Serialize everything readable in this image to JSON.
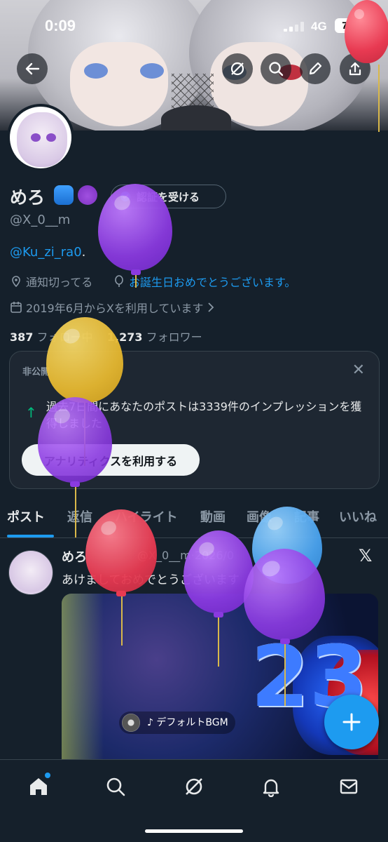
{
  "status_bar": {
    "time": "0:09",
    "network": "4G",
    "battery": "77"
  },
  "profile": {
    "name": "めろ",
    "verify_button": "認証を受ける",
    "handle": "@X_0__m",
    "bio_link": "@Ku_zi_ra0",
    "bio_suffix": ".",
    "location": "通知切ってる",
    "birthday_link": "お誕生日おめでとうございます。",
    "joined": "2019年6月からXを利用しています",
    "following_count": "387",
    "following_label": "フォロー中",
    "followers_count": "1,273",
    "followers_label": "フォロワー"
  },
  "analytics_card": {
    "tag": "非公開",
    "message": "過去7日間にあなたのポストは3339件のインプレッションを獲得しました",
    "cta": "アナリティクスを利用する"
  },
  "tabs": [
    "ポスト",
    "返信",
    "ハイライト",
    "動画",
    "画像",
    "記事",
    "いいね"
  ],
  "post": {
    "name": "めろ",
    "handle_date": "@X_0__m·2026/0",
    "text": "あけましておめでとうございます",
    "image_label": "♪ デフォルトBGM",
    "image_number": "23"
  },
  "colors": {
    "accent": "#1d9bf0",
    "background": "#15202b",
    "card": "#1e2732",
    "border": "#38444d",
    "muted": "#8b98a5"
  },
  "icons": {
    "header": [
      "back-arrow-icon",
      "grok-icon",
      "search-icon",
      "pencil-icon",
      "share-icon"
    ],
    "bottom_nav": [
      "home-icon",
      "search-icon",
      "grok-icon",
      "bell-icon",
      "mail-icon"
    ]
  }
}
